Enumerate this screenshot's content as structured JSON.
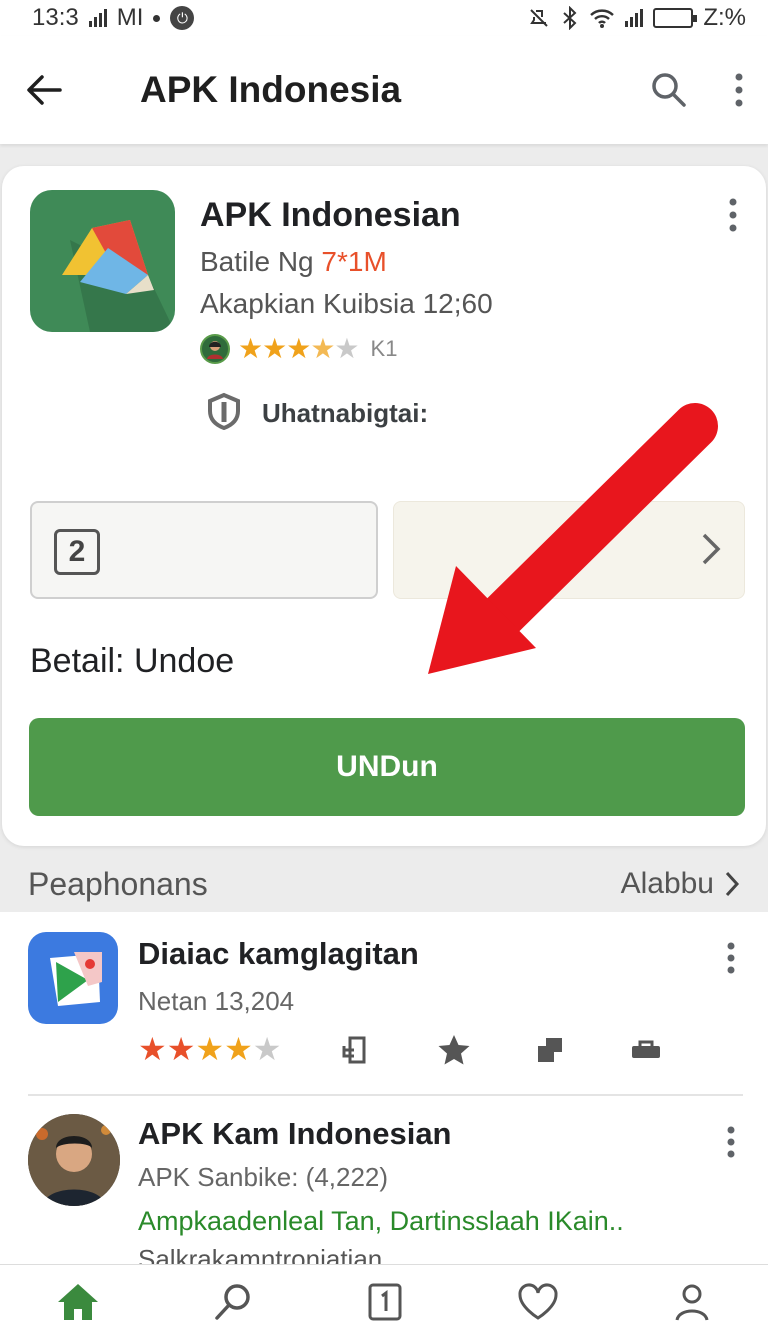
{
  "status_bar": {
    "time": "13:3",
    "carrier": "MI",
    "battery_text": "Z:%"
  },
  "app_bar": {
    "title": "APK Indonesia"
  },
  "app_card": {
    "name": "APK Indonesian",
    "developer": "Batile Ng",
    "developer_highlight": "7*1M",
    "meta": "Akapkian Kuibsia 12;60",
    "rating_count": "K1",
    "rating_stars": 3.5,
    "badge_label": "Uhatnabigtai:",
    "choice_number": "2",
    "detail_text": "Betail: Undoe",
    "install_label": "UNDun"
  },
  "section": {
    "title": "Peaphonans",
    "link": "Alabbu"
  },
  "list_items": [
    {
      "name": "Diaiac kamglagitan",
      "subtitle": "Netan 13,204",
      "rating_stars": 3.5
    },
    {
      "name": "APK Kam Indonesian",
      "subtitle": "APK Sanbike: (4,222)",
      "description": "Ampkaadenleal Tan, Dartinsslaah IKain..",
      "extra": "Salkrakamntroniatian"
    }
  ],
  "colors": {
    "accent_green": "#4f9a4b",
    "star": "#f0a21b",
    "arrow_red": "#e8161d",
    "link_green": "#2a8a2a"
  },
  "icons": {
    "back": "back-arrow-icon",
    "search": "search-icon",
    "more": "more-vert-icon",
    "badge": "shield-icon",
    "chevron": "chevron-right-icon",
    "nav": [
      "home-icon",
      "search-icon",
      "apps-icon",
      "heart-icon",
      "profile-icon"
    ]
  }
}
